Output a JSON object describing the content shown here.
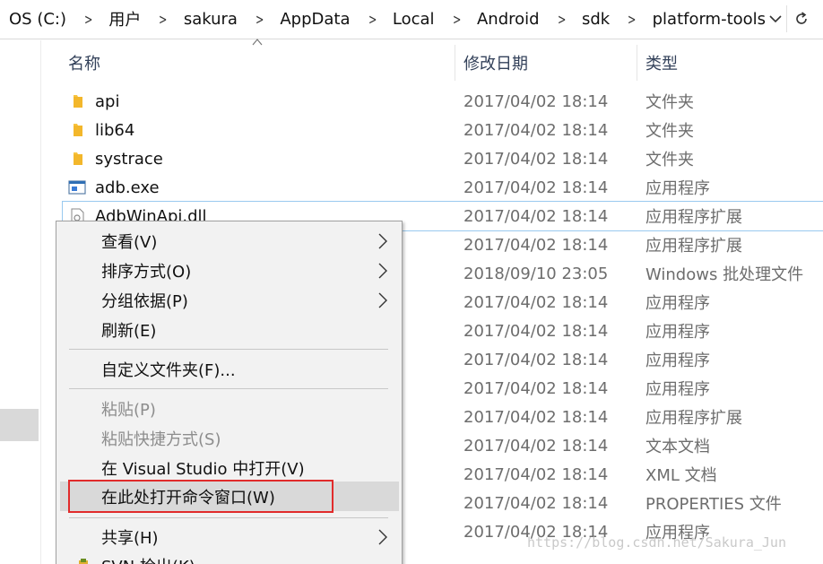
{
  "breadcrumb": [
    "OS (C:)",
    "用户",
    "sakura",
    "AppData",
    "Local",
    "Android",
    "sdk",
    "platform-tools"
  ],
  "columns": {
    "name": "名称",
    "date": "修改日期",
    "type": "类型"
  },
  "files": [
    {
      "name": "api",
      "date": "2017/04/02 18:14",
      "type": "文件夹",
      "icon": "folder-icon"
    },
    {
      "name": "lib64",
      "date": "2017/04/02 18:14",
      "type": "文件夹",
      "icon": "folder-icon"
    },
    {
      "name": "systrace",
      "date": "2017/04/02 18:14",
      "type": "文件夹",
      "icon": "folder-icon"
    },
    {
      "name": "adb.exe",
      "date": "2017/04/02 18:14",
      "type": "应用程序",
      "icon": "exe-icon"
    },
    {
      "name": "AdbWinApi.dll",
      "date": "2017/04/02 18:14",
      "type": "应用程序扩展",
      "icon": "dll-icon"
    },
    {
      "name": "",
      "date": "2017/04/02 18:14",
      "type": "应用程序扩展"
    },
    {
      "name": "",
      "date": "2018/09/10 23:05",
      "type": "Windows 批处理文件"
    },
    {
      "name": "",
      "date": "2017/04/02 18:14",
      "type": "应用程序"
    },
    {
      "name": "",
      "date": "2017/04/02 18:14",
      "type": "应用程序"
    },
    {
      "name": "",
      "date": "2017/04/02 18:14",
      "type": "应用程序"
    },
    {
      "name": "",
      "date": "2017/04/02 18:14",
      "type": "应用程序"
    },
    {
      "name": "",
      "date": "2017/04/02 18:14",
      "type": "应用程序扩展"
    },
    {
      "name": "",
      "date": "2017/04/02 18:14",
      "type": "文本文档"
    },
    {
      "name": "",
      "date": "2017/04/02 18:14",
      "type": "XML 文档"
    },
    {
      "name": "",
      "date": "2017/04/02 18:14",
      "type": "PROPERTIES 文件"
    },
    {
      "name": "",
      "date": "2017/04/02 18:14",
      "type": "应用程序"
    }
  ],
  "context_menu": {
    "view": "查看(V)",
    "sort_by": "排序方式(O)",
    "group_by": "分组依据(P)",
    "refresh": "刷新(E)",
    "customize_folder": "自定义文件夹(F)...",
    "paste": "粘贴(P)",
    "paste_shortcut": "粘贴快捷方式(S)",
    "open_in_vs": "在 Visual Studio 中打开(V)",
    "open_cmd_here": "在此处打开命令窗口(W)",
    "share": "共享(H)",
    "svn_checkout": "SVN 检出(K)..."
  },
  "watermark": "https://blog.csdn.net/Sakura_Jun",
  "colors": {
    "highlight_border": "#e12b2b",
    "selection_outline": "#99c9ef",
    "folder": "#f8c440"
  }
}
